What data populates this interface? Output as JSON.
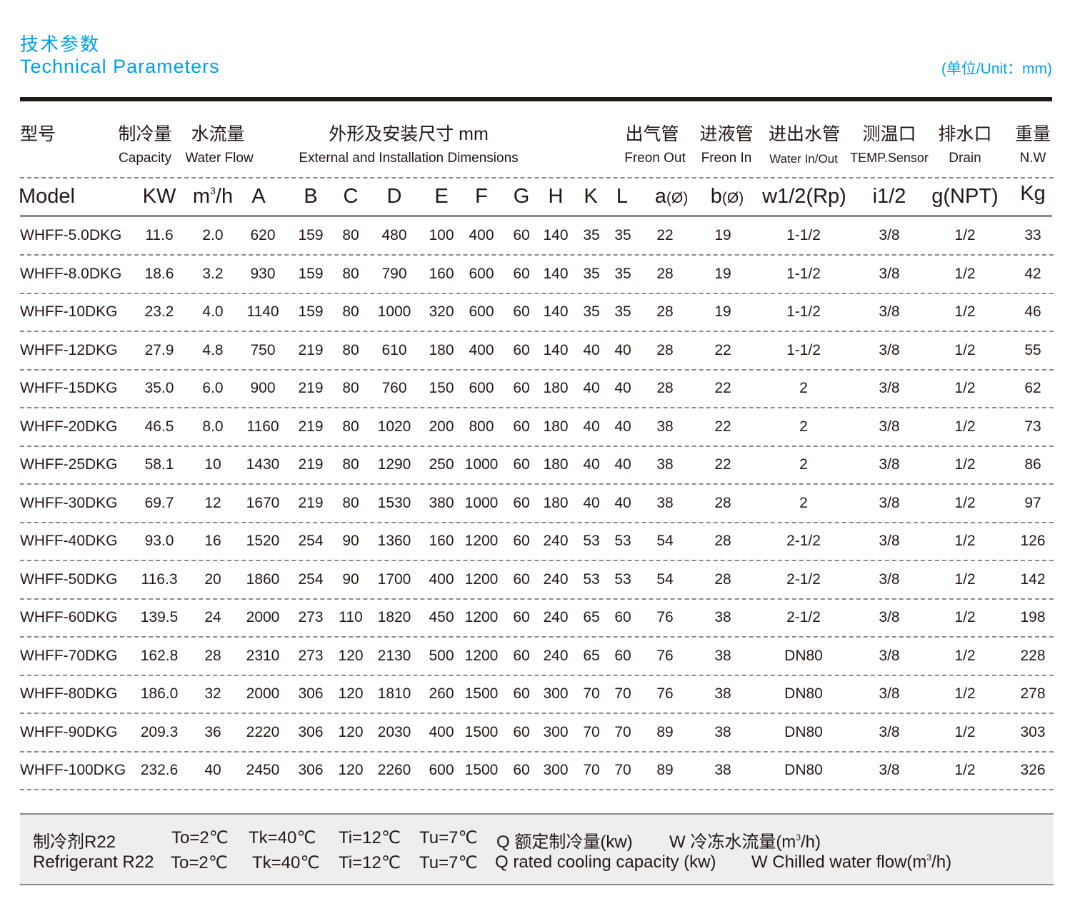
{
  "header": {
    "title_cn": "技术参数",
    "title_en": "Technical Parameters",
    "unit_note": "(单位/Unit：mm)"
  },
  "table": {
    "column_groups_cn": {
      "model": "型号",
      "capacity": "制冷量",
      "water_flow": "水流量",
      "dimensions": "外形及安装尺寸 mm",
      "freon_out": "出气管",
      "freon_in": "进液管",
      "water_in_out": "进出水管",
      "temp_sensor": "测温口",
      "drain": "排水口",
      "weight": "重量"
    },
    "column_groups_en": {
      "capacity": "Capacity",
      "water_flow": "Water Flow",
      "dimensions": "External and Installation Dimensions",
      "freon_out": "Freon Out",
      "freon_in": "Freon In",
      "water_in_out": "Water In/Out",
      "temp_sensor": "TEMP.Sensor",
      "drain": "Drain",
      "weight": "N.W"
    },
    "unit_headers": {
      "model": "Model",
      "kw": "KW",
      "flow_m": "m",
      "flow_sup": "3",
      "flow_h": "/h",
      "A": "A",
      "B": "B",
      "C": "C",
      "D": "D",
      "E": "E",
      "F": "F",
      "G": "G",
      "H": "H",
      "K": "K",
      "L": "L",
      "a": "a",
      "a_sub": "(Ø)",
      "b": "b",
      "b_sub": "(Ø)",
      "w": "w1/2(Rp)",
      "i": "i1/2",
      "g": "g(NPT)",
      "kg": "Kg"
    },
    "columns": [
      "model",
      "kw",
      "flow",
      "A",
      "B",
      "C",
      "D",
      "E",
      "F",
      "G",
      "H",
      "K",
      "L",
      "a",
      "b",
      "w",
      "i",
      "g",
      "kg"
    ],
    "rows": [
      [
        "WHFF-5.0DKG",
        "11.6",
        "2.0",
        "620",
        "159",
        "80",
        "480",
        "100",
        "400",
        "60",
        "140",
        "35",
        "35",
        "22",
        "19",
        "1-1/2",
        "3/8",
        "1/2",
        "33"
      ],
      [
        "WHFF-8.0DKG",
        "18.6",
        "3.2",
        "930",
        "159",
        "80",
        "790",
        "160",
        "600",
        "60",
        "140",
        "35",
        "35",
        "28",
        "19",
        "1-1/2",
        "3/8",
        "1/2",
        "42"
      ],
      [
        "WHFF-10DKG",
        "23.2",
        "4.0",
        "1140",
        "159",
        "80",
        "1000",
        "320",
        "600",
        "60",
        "140",
        "35",
        "35",
        "28",
        "19",
        "1-1/2",
        "3/8",
        "1/2",
        "46"
      ],
      [
        "WHFF-12DKG",
        "27.9",
        "4.8",
        "750",
        "219",
        "80",
        "610",
        "180",
        "400",
        "60",
        "140",
        "40",
        "40",
        "28",
        "22",
        "1-1/2",
        "3/8",
        "1/2",
        "55"
      ],
      [
        "WHFF-15DKG",
        "35.0",
        "6.0",
        "900",
        "219",
        "80",
        "760",
        "150",
        "600",
        "60",
        "180",
        "40",
        "40",
        "28",
        "22",
        "2",
        "3/8",
        "1/2",
        "62"
      ],
      [
        "WHFF-20DKG",
        "46.5",
        "8.0",
        "1160",
        "219",
        "80",
        "1020",
        "200",
        "800",
        "60",
        "180",
        "40",
        "40",
        "38",
        "22",
        "2",
        "3/8",
        "1/2",
        "73"
      ],
      [
        "WHFF-25DKG",
        "58.1",
        "10",
        "1430",
        "219",
        "80",
        "1290",
        "250",
        "1000",
        "60",
        "180",
        "40",
        "40",
        "38",
        "22",
        "2",
        "3/8",
        "1/2",
        "86"
      ],
      [
        "WHFF-30DKG",
        "69.7",
        "12",
        "1670",
        "219",
        "80",
        "1530",
        "380",
        "1000",
        "60",
        "180",
        "40",
        "40",
        "38",
        "28",
        "2",
        "3/8",
        "1/2",
        "97"
      ],
      [
        "WHFF-40DKG",
        "93.0",
        "16",
        "1520",
        "254",
        "90",
        "1360",
        "160",
        "1200",
        "60",
        "240",
        "53",
        "53",
        "54",
        "28",
        "2-1/2",
        "3/8",
        "1/2",
        "126"
      ],
      [
        "WHFF-50DKG",
        "116.3",
        "20",
        "1860",
        "254",
        "90",
        "1700",
        "400",
        "1200",
        "60",
        "240",
        "53",
        "53",
        "54",
        "28",
        "2-1/2",
        "3/8",
        "1/2",
        "142"
      ],
      [
        "WHFF-60DKG",
        "139.5",
        "24",
        "2000",
        "273",
        "110",
        "1820",
        "450",
        "1200",
        "60",
        "240",
        "65",
        "60",
        "76",
        "38",
        "2-1/2",
        "3/8",
        "1/2",
        "198"
      ],
      [
        "WHFF-70DKG",
        "162.8",
        "28",
        "2310",
        "273",
        "120",
        "2130",
        "500",
        "1200",
        "60",
        "240",
        "65",
        "60",
        "76",
        "38",
        "DN80",
        "3/8",
        "1/2",
        "228"
      ],
      [
        "WHFF-80DKG",
        "186.0",
        "32",
        "2000",
        "306",
        "120",
        "1810",
        "260",
        "1500",
        "60",
        "300",
        "70",
        "70",
        "76",
        "38",
        "DN80",
        "3/8",
        "1/2",
        "278"
      ],
      [
        "WHFF-90DKG",
        "209.3",
        "36",
        "2220",
        "306",
        "120",
        "2030",
        "400",
        "1500",
        "60",
        "300",
        "70",
        "70",
        "89",
        "38",
        "DN80",
        "3/8",
        "1/2",
        "303"
      ],
      [
        "WHFF-100DKG",
        "232.6",
        "40",
        "2450",
        "306",
        "120",
        "2260",
        "600",
        "1500",
        "60",
        "300",
        "70",
        "70",
        "89",
        "38",
        "DN80",
        "3/8",
        "1/2",
        "326"
      ]
    ]
  },
  "notes": {
    "cn": {
      "refrigerant": "制冷剂R22",
      "to": "To=2℃",
      "tk": "Tk=40℃",
      "ti": "Ti=12℃",
      "tu": "Tu=7℃",
      "q": "Q 额定制冷量(kw)",
      "w_prefix": "W 冷冻水流量(m",
      "w_sup": "3",
      "w_suffix": "/h)"
    },
    "en": {
      "refrigerant": "Refrigerant R22",
      "to": "To=2℃",
      "tk": "Tk=40℃",
      "ti": "Ti=12℃",
      "tu": "Tu=7℃",
      "q": "Q rated cooling capacity (kw)",
      "w_prefix": "W Chilled water flow(m",
      "w_sup": "3",
      "w_suffix": "/h)"
    }
  }
}
